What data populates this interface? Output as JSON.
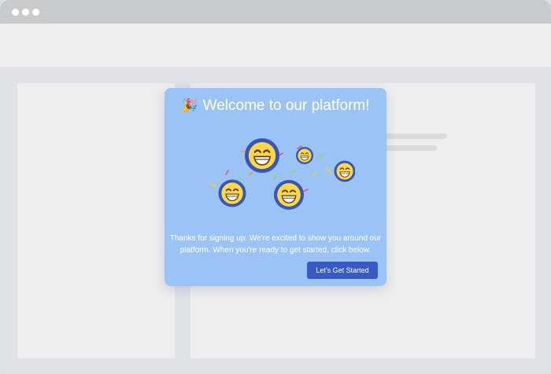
{
  "window": {
    "traffic_lights": [
      "#ffffff",
      "#ffffff",
      "#ffffff"
    ]
  },
  "modal": {
    "title_icon": "party-popper-icon",
    "title_emoji": "🎉",
    "title": "Welcome to our platform!",
    "body_line_1": "Thanks for signing up. We're excited to show you around our",
    "body_line_2": "platform. When you're ready to get started, click below.",
    "cta_label": "Let's Get Started",
    "colors": {
      "background": "#9bc3f6",
      "button": "#3959c7",
      "emoji_ring": "#3457b8",
      "emoji_face": "#ffd54a"
    }
  },
  "illustration": {
    "icon": "celebrating-emoji-faces-icon"
  }
}
